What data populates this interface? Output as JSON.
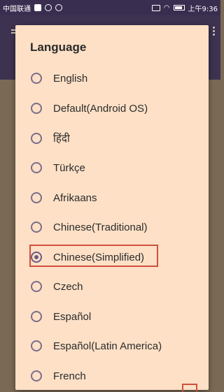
{
  "status_bar": {
    "carrier": "中国联通",
    "time": "上午9:36"
  },
  "dialog": {
    "title": "Language",
    "options": [
      {
        "label": "English",
        "checked": false
      },
      {
        "label": "Default(Android OS)",
        "checked": false
      },
      {
        "label": "हिंदी",
        "checked": false
      },
      {
        "label": "Türkçe",
        "checked": false
      },
      {
        "label": "Afrikaans",
        "checked": false
      },
      {
        "label": "Chinese(Traditional)",
        "checked": false
      },
      {
        "label": "Chinese(Simplified)",
        "checked": true
      },
      {
        "label": "Czech",
        "checked": false
      },
      {
        "label": "Español",
        "checked": false
      },
      {
        "label": "Español(Latin America)",
        "checked": false
      },
      {
        "label": "French",
        "checked": false
      }
    ]
  },
  "colors": {
    "dialog_bg": "#fde0c6",
    "radio_accent": "#6a5a86",
    "highlight": "#d0503c",
    "status_bar_bg": "#3a2e50"
  },
  "icons": [
    "wechat-icon",
    "cloud-icon",
    "camera-icon",
    "cast-icon",
    "wifi-icon",
    "battery-icon"
  ]
}
